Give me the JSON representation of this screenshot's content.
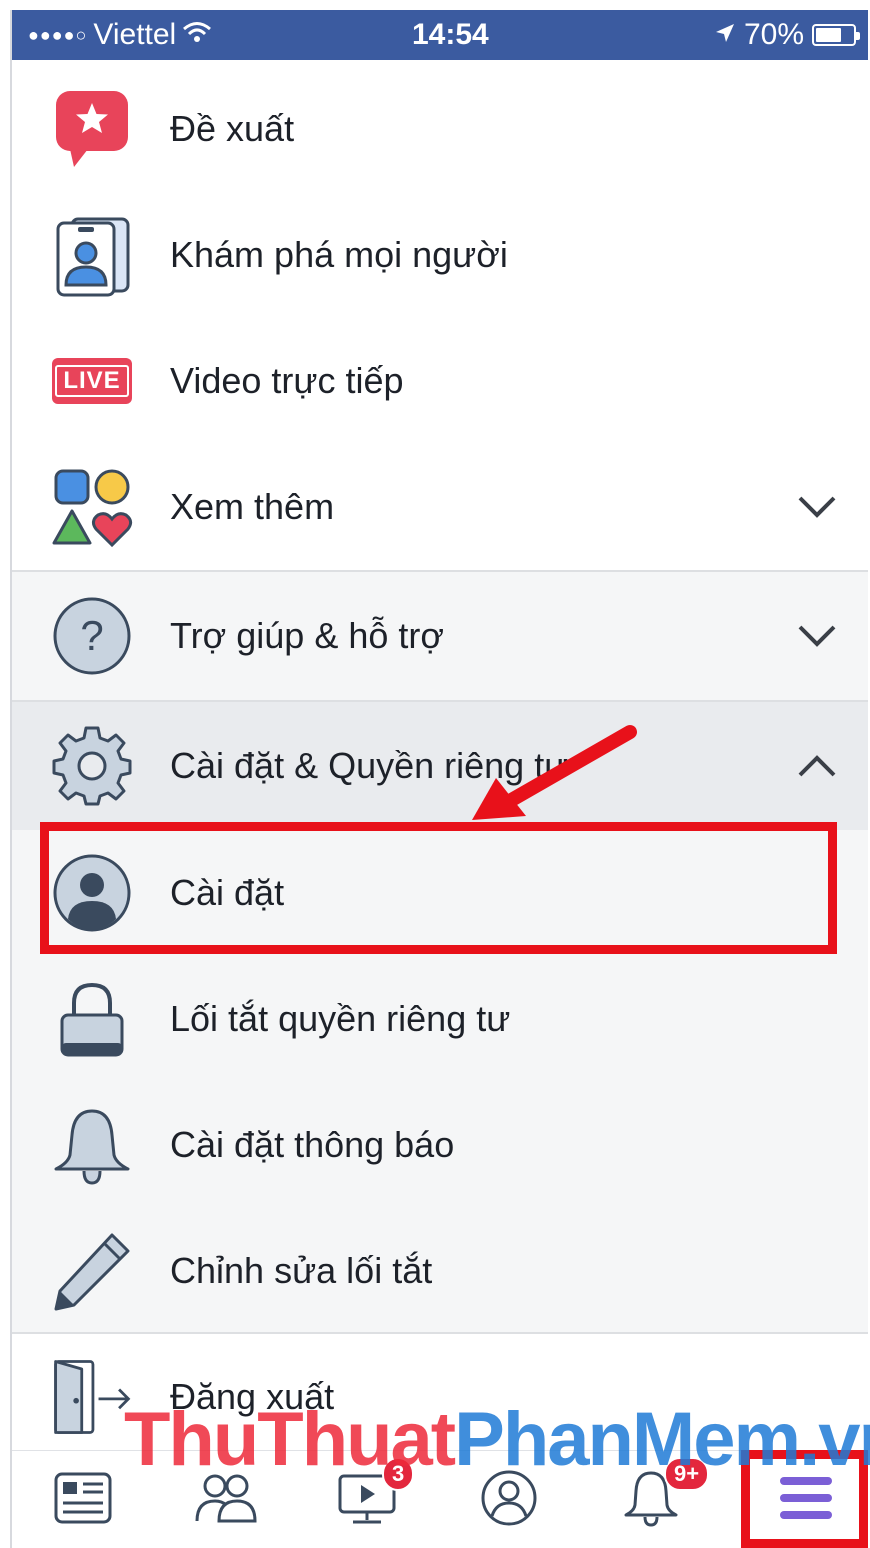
{
  "status_bar": {
    "signal": "●●●●○",
    "carrier": "Viettel",
    "time": "14:54",
    "battery": "70%",
    "battery_level": 0.7
  },
  "menu": {
    "items": [
      {
        "label": "Đề xuất",
        "icon": "recommendation-star-icon"
      },
      {
        "label": "Khám phá mọi người",
        "icon": "discover-people-icon"
      },
      {
        "label": "Video trực tiếp",
        "icon": "live-video-icon",
        "icon_text": "LIVE"
      },
      {
        "label": "Xem thêm",
        "icon": "see-more-shapes-icon",
        "expand": "chevron-down-icon"
      },
      {
        "label": "Trợ giúp & hỗ trợ",
        "icon": "help-question-icon",
        "expand": "chevron-down-icon"
      },
      {
        "label": "Cài đặt & Quyền riêng tư",
        "icon": "gear-icon",
        "expand": "chevron-up-icon"
      },
      {
        "label": "Cài đặt",
        "icon": "user-avatar-icon"
      },
      {
        "label": "Lối tắt quyền riêng tư",
        "icon": "lock-icon"
      },
      {
        "label": "Cài đặt thông báo",
        "icon": "bell-icon"
      },
      {
        "label": "Chỉnh sửa lối tắt",
        "icon": "pencil-icon"
      },
      {
        "label": "Đăng xuất",
        "icon": "logout-door-icon"
      }
    ]
  },
  "tab_bar": {
    "tabs": [
      {
        "icon": "news-feed-icon"
      },
      {
        "icon": "friends-icon"
      },
      {
        "icon": "watch-video-icon",
        "badge": "3"
      },
      {
        "icon": "profile-icon"
      },
      {
        "icon": "notifications-bell-icon",
        "badge": "9+"
      },
      {
        "icon": "menu-hamburger-icon"
      }
    ]
  },
  "watermark": {
    "part1": "ThuThuat",
    "part2": "PhanMem.vn"
  },
  "colors": {
    "status_bar": "#3b5ba0",
    "highlight": "#e8111a",
    "badge": "#e3273d",
    "menu_active": "#7b5fd6"
  }
}
